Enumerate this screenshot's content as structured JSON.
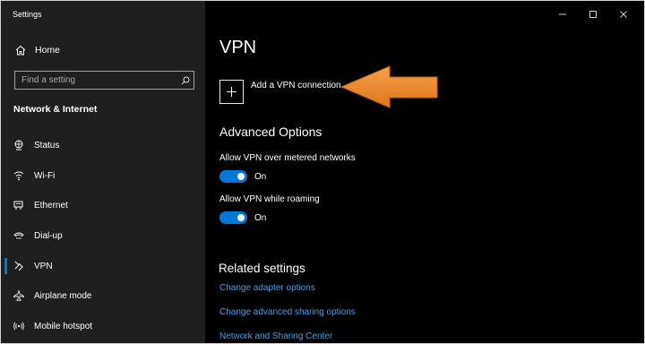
{
  "app": {
    "title": "Settings"
  },
  "sidebar": {
    "home_label": "Home",
    "search_placeholder": "Find a setting",
    "section_title": "Network & Internet",
    "items": [
      {
        "label": "Status",
        "icon": "status-icon"
      },
      {
        "label": "Wi-Fi",
        "icon": "wifi-icon"
      },
      {
        "label": "Ethernet",
        "icon": "ethernet-icon"
      },
      {
        "label": "Dial-up",
        "icon": "dialup-icon"
      },
      {
        "label": "VPN",
        "icon": "vpn-icon",
        "active": true
      },
      {
        "label": "Airplane mode",
        "icon": "airplane-icon"
      },
      {
        "label": "Mobile hotspot",
        "icon": "hotspot-icon"
      }
    ]
  },
  "main": {
    "title": "VPN",
    "add_vpn_label": "Add a VPN connection",
    "advanced_title": "Advanced Options",
    "options": [
      {
        "label": "Allow VPN over metered networks",
        "state": "On",
        "on": true
      },
      {
        "label": "Allow VPN while roaming",
        "state": "On",
        "on": true
      }
    ],
    "related_title": "Related settings",
    "links": [
      "Change adapter options",
      "Change advanced sharing options",
      "Network and Sharing Center"
    ]
  },
  "colors": {
    "sidebar_bg": "#1f1f1f",
    "main_bg": "#000000",
    "accent": "#0078d7",
    "link": "#4a9fe8",
    "arrow": "#f08a24"
  }
}
